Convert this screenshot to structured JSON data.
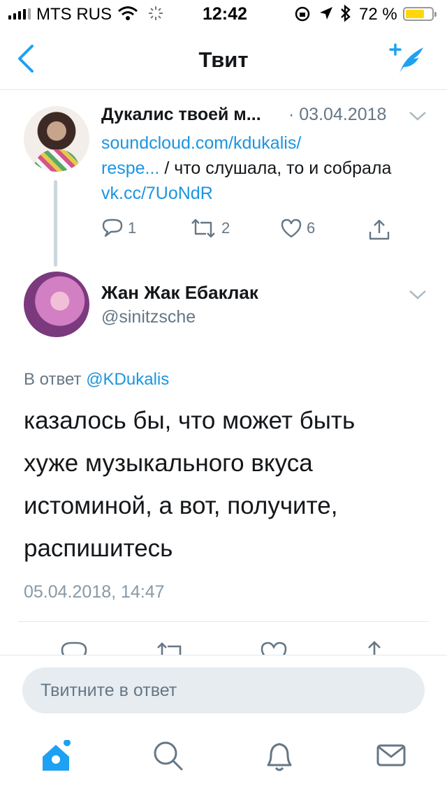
{
  "status_bar": {
    "carrier": "MTS RUS",
    "time": "12:42",
    "battery_percent": "72 %",
    "battery_level": 0.72
  },
  "nav": {
    "title": "Твит"
  },
  "parent_tweet": {
    "author": "Дукалис твоей м...",
    "separator": "·",
    "date": "03.04.2018",
    "link1": "soundcloud.com/kdukalis/",
    "link1b": "respe...",
    "text": " / что слушала, то и собрала ",
    "link2": "vk.cc/7UoNdR",
    "replies": "1",
    "retweets": "2",
    "likes": "6"
  },
  "main_tweet": {
    "author": "Жан Жак Ебаклак",
    "handle": "@sinitzsche",
    "replying_prefix": "В ответ",
    "replying_to": "@KDukalis",
    "text": "казалось бы, что может быть хуже музыкального вкуса истоминой, а вот, получите, распишитесь",
    "timestamp": "05.04.2018, 14:47"
  },
  "reply": {
    "placeholder": "Твитните в ответ"
  },
  "icons": [
    "back-chevron-icon",
    "compose-icon",
    "reply-icon",
    "retweet-icon",
    "like-icon",
    "share-icon",
    "home-icon",
    "search-icon",
    "notifications-icon",
    "messages-icon"
  ],
  "colors": {
    "accent": "#1da1f2",
    "link": "#1b95e0",
    "secondary_text": "#657786"
  }
}
